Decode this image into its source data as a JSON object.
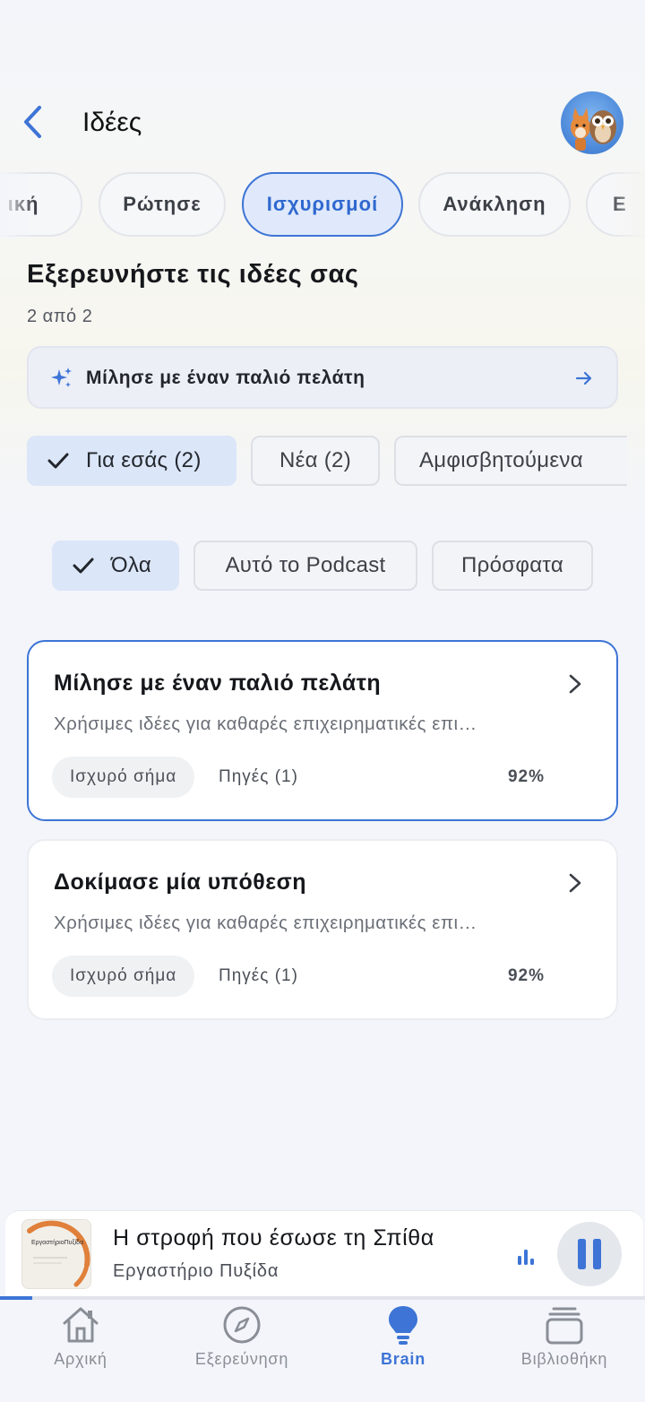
{
  "header": {
    "title": "Ιδέες"
  },
  "tabs": [
    {
      "label": "ική"
    },
    {
      "label": "Ρώτησε"
    },
    {
      "label": "Ισχυρισμοί",
      "active": true
    },
    {
      "label": "Ανάκληση"
    },
    {
      "label": "Ε"
    }
  ],
  "section": {
    "title": "Εξερευνήστε τις ιδέες σας",
    "count": "2 από 2"
  },
  "suggestion": {
    "label": "Μίλησε με έναν παλιό πελάτη",
    "icon": "sparkles-icon"
  },
  "filters_primary": [
    {
      "label": "Για εσάς (2)",
      "selected": true
    },
    {
      "label": "Νέα (2)"
    },
    {
      "label": "Αμφισβητούμενα"
    }
  ],
  "filters_secondary": [
    {
      "label": "Όλα",
      "selected": true
    },
    {
      "label": "Αυτό το Podcast"
    },
    {
      "label": "Πρόσφατα"
    }
  ],
  "cards": [
    {
      "title": "Μίλησε με έναν παλιό πελάτη",
      "description": "Χρήσιμες ιδέες για καθαρές επιχειρηματικές επι…",
      "badge": "Ισχυρό σήμα",
      "sources": "Πηγές (1)",
      "score": "92%"
    },
    {
      "title": "Δοκίμασε μία υπόθεση",
      "description": "Χρήσιμες ιδέες για καθαρές επιχειρηματικές επι…",
      "badge": "Ισχυρό σήμα",
      "sources": "Πηγές (1)",
      "score": "92%"
    }
  ],
  "player": {
    "title": "Η στροφή που έσωσε τη Σπίθα",
    "subtitle": "Εργαστήριο Πυξίδα",
    "cover_text": "ΕργαστήριοΠυξίδα",
    "progress": 0.05
  },
  "tabbar": [
    {
      "label": "Αρχική",
      "icon": "home-icon"
    },
    {
      "label": "Εξερεύνηση",
      "icon": "compass-icon"
    },
    {
      "label": "Brain",
      "icon": "lightbulb-icon",
      "active": true
    },
    {
      "label": "Βιβλιοθήκη",
      "icon": "library-icon"
    }
  ],
  "colors": {
    "accent": "#3d74d6",
    "background": "#f3f5fa",
    "chip_selected": "#dbe6f8"
  }
}
